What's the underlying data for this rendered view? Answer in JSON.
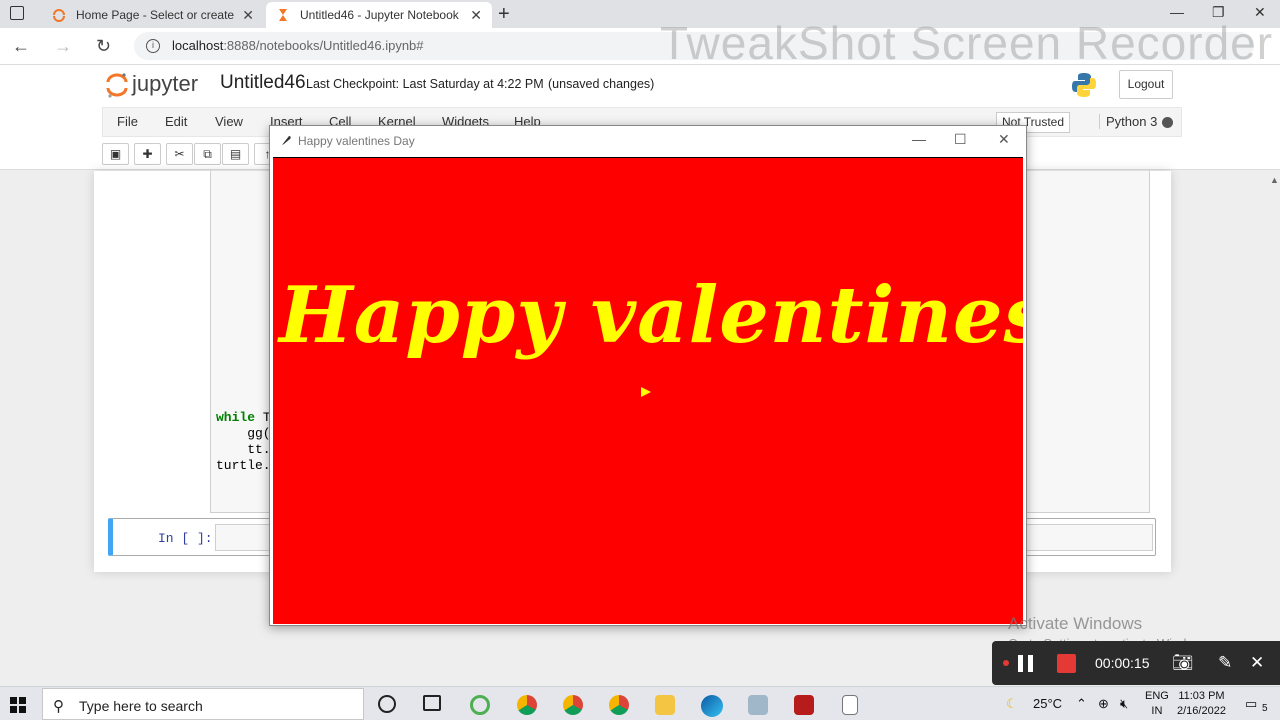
{
  "browser": {
    "tabs": [
      {
        "title": "Home Page - Select or create a n",
        "active": false
      },
      {
        "title": "Untitled46 - Jupyter Notebook",
        "active": true
      }
    ],
    "url_host": "localhost",
    "url_rest": ":8888/notebooks/Untitled46.ipynb#"
  },
  "watermark": "TweakShot Screen Recorder",
  "jupyter": {
    "logo_text": "jupyter",
    "notebook_title": "Untitled46",
    "checkpoint": "Last Checkpoint: Last Saturday at 4:22 PM",
    "unsaved": "(unsaved changes)",
    "logout": "Logout",
    "menu": [
      "File",
      "Edit",
      "View",
      "Insert",
      "Cell",
      "Kernel",
      "Widgets",
      "Help"
    ],
    "trust": "Not Trusted",
    "kernel": "Python 3",
    "code_lines": [
      {
        "kw": "while",
        "rest": " Tr"
      },
      {
        "kw": "",
        "rest": "    gg()"
      },
      {
        "kw": "",
        "rest": "    tt.c"
      },
      {
        "kw": "",
        "rest": "turtle.m"
      }
    ],
    "empty_cell_prompt": "In [ ]:"
  },
  "turtle_window": {
    "title": "Happy valentines Day",
    "canvas_text": "Happy valentines Day",
    "canvas_color": "#ff0000",
    "text_color": "#ffff00"
  },
  "activate_windows": {
    "line1": "Activate Windows",
    "line2": "Go to Settings to activate Windows."
  },
  "recorder": {
    "elapsed": "00:00:15"
  },
  "taskbar": {
    "search_placeholder": "Type here to search",
    "weather": "25°C",
    "language": "ENG",
    "region": "IN",
    "time": "11:03 PM",
    "date": "2/16/2022",
    "notification_count": "5"
  }
}
